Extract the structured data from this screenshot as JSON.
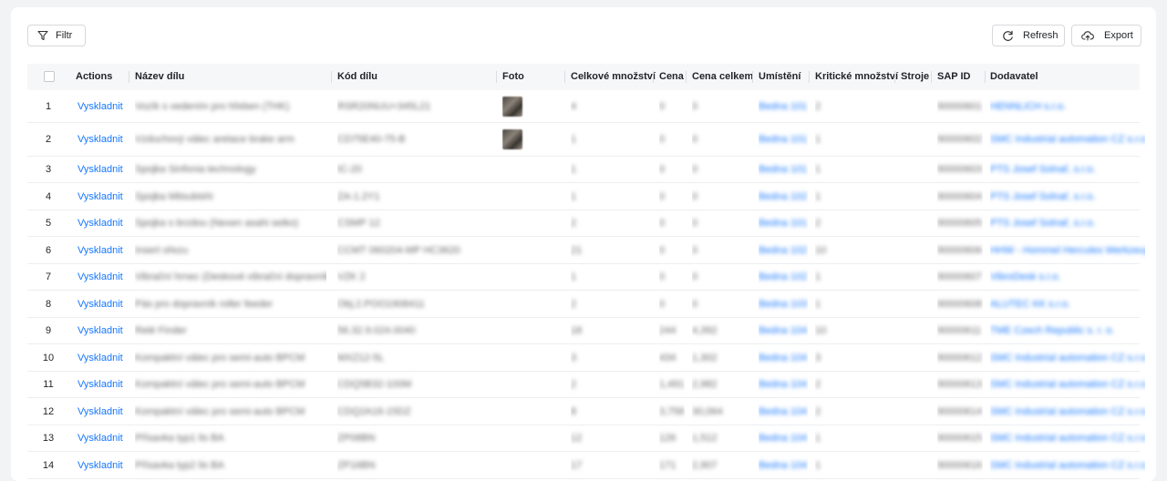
{
  "toolbar": {
    "filter_label": "Filtr",
    "refresh_label": "Refresh",
    "export_label": "Export"
  },
  "table": {
    "columns": {
      "actions": "Actions",
      "name": "Název dílu",
      "code": "Kód dílu",
      "photo": "Foto",
      "qty": "Celkové množství",
      "price": "Cena",
      "total": "Cena celkem",
      "location": "Umístění",
      "critical": "Kritické množství",
      "machines": "Stroje",
      "sap": "SAP ID",
      "supplier": "Dodavatel"
    },
    "rows": [
      {
        "no": "1",
        "action": "Vyskladnit",
        "name": "Vozík s vedením pro hřeben (THK)",
        "code": "RSR20NUU+345L21",
        "photo": true,
        "qty": "4",
        "price": "0",
        "total": "0",
        "location": "Bedna 101",
        "critical": "2",
        "sap": "90000601",
        "supplier": "HENNLICH s.r.o."
      },
      {
        "no": "2",
        "action": "Vyskladnit",
        "name": "Vzduchový válec aretace brake arm",
        "code": "CD75E40-75-B",
        "photo": true,
        "qty": "1",
        "price": "0",
        "total": "0",
        "location": "Bedna 101",
        "critical": "1",
        "sap": "90000602",
        "supplier": "SMC Industrial automation CZ s.r.o."
      },
      {
        "no": "3",
        "action": "Vyskladnit",
        "name": "Spojka Sinfonia technology",
        "code": "IC-20",
        "photo": false,
        "qty": "1",
        "price": "0",
        "total": "0",
        "location": "Bedna 101",
        "critical": "1",
        "sap": "90000603",
        "supplier": "PTS Josef Solnař, s.r.o."
      },
      {
        "no": "4",
        "action": "Vyskladnit",
        "name": "Spojka Mitsubishi",
        "code": "ZA-1.2Y1",
        "photo": false,
        "qty": "1",
        "price": "0",
        "total": "0",
        "location": "Bedna 102",
        "critical": "1",
        "sap": "90000604",
        "supplier": "PTS Josef Solnař, s.r.o."
      },
      {
        "no": "5",
        "action": "Vyskladnit",
        "name": "Spojka s brzdou (Nexen asahi seiko)",
        "code": "CSMP 12",
        "photo": false,
        "qty": "2",
        "price": "0",
        "total": "0",
        "location": "Bedna 101",
        "critical": "2",
        "sap": "90000605",
        "supplier": "PTS Josef Solnař, s.r.o."
      },
      {
        "no": "6",
        "action": "Vyskladnit",
        "name": "Insert ořezu",
        "code": "CCMT 060204-MP HC3620",
        "photo": false,
        "qty": "21",
        "price": "0",
        "total": "0",
        "location": "Bedna 102",
        "critical": "10",
        "sap": "90000606",
        "supplier": "HHW - Hommel Hercules Werkzeug"
      },
      {
        "no": "7",
        "action": "Vyskladnit",
        "name": "Vibrační hrnec (Deskové vibrační dopravníky)",
        "code": "VZK 2",
        "photo": false,
        "qty": "1",
        "price": "0",
        "total": "0",
        "location": "Bedna 102",
        "critical": "1",
        "sap": "90000607",
        "supplier": "VibroDesk s.r.o."
      },
      {
        "no": "8",
        "action": "Vyskladnit",
        "name": "Pás pro dopravník roller feeder",
        "code": "Obj.2.POO1908411",
        "photo": false,
        "qty": "2",
        "price": "0",
        "total": "0",
        "location": "Bedna 103",
        "critical": "1",
        "sap": "90000608",
        "supplier": "ALUTEC KK s.r.o."
      },
      {
        "no": "9",
        "action": "Vyskladnit",
        "name": "Relé Finder",
        "code": "56.32.9.024.0040",
        "photo": false,
        "qty": "18",
        "price": "244",
        "total": "4,392",
        "location": "Bedna 104",
        "critical": "10",
        "sap": "90000611",
        "supplier": "TME Czech Republic s. r. o."
      },
      {
        "no": "10",
        "action": "Vyskladnit",
        "name": "Kompaktní válec pro semi-auto BPCM",
        "code": "MXZ12-5L",
        "photo": false,
        "qty": "3",
        "price": "434",
        "total": "1,302",
        "location": "Bedna 104",
        "critical": "3",
        "sap": "90000612",
        "supplier": "SMC Industrial automation CZ s.r.o."
      },
      {
        "no": "11",
        "action": "Vyskladnit",
        "name": "Kompaktní válec pro semi-auto BPCM",
        "code": "CDQ5B32-100M",
        "photo": false,
        "qty": "2",
        "price": "1,491",
        "total": "2,982",
        "location": "Bedna 104",
        "critical": "2",
        "sap": "90000613",
        "supplier": "SMC Industrial automation CZ s.r.o."
      },
      {
        "no": "12",
        "action": "Vyskladnit",
        "name": "Kompaktní válec pro semi-auto BPCM",
        "code": "CDQ2A16-15DZ",
        "photo": false,
        "qty": "8",
        "price": "3,758",
        "total": "30,064",
        "location": "Bedna 104",
        "critical": "2",
        "sap": "90000614",
        "supplier": "SMC Industrial automation CZ s.r.o."
      },
      {
        "no": "13",
        "action": "Vyskladnit",
        "name": "Přísavka typ1 lis BA",
        "code": "ZP08BN",
        "photo": false,
        "qty": "12",
        "price": "126",
        "total": "1,512",
        "location": "Bedna 104",
        "critical": "1",
        "sap": "90000615",
        "supplier": "SMC Industrial automation CZ s.r.o."
      },
      {
        "no": "14",
        "action": "Vyskladnit",
        "name": "Přísavka typ2 lis BA",
        "code": "ZP16BN",
        "photo": false,
        "qty": "17",
        "price": "171",
        "total": "2,907",
        "location": "Bedna 104",
        "critical": "1",
        "sap": "90000616",
        "supplier": "SMC Industrial automation CZ s.r.o."
      }
    ]
  }
}
